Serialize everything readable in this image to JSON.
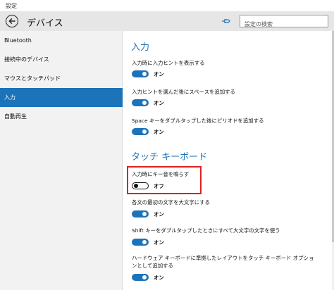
{
  "window": {
    "title": "設定"
  },
  "header": {
    "title": "デバイス",
    "search_placeholder": "設定の検索"
  },
  "sidebar": {
    "items": [
      {
        "label": "Bluetooth",
        "selected": false
      },
      {
        "label": "接続中のデバイス",
        "selected": false
      },
      {
        "label": "マウスとタッチパッド",
        "selected": false
      },
      {
        "label": "入力",
        "selected": true
      },
      {
        "label": "自動再生",
        "selected": false
      }
    ]
  },
  "content": {
    "input_section": {
      "title": "入力",
      "settings": [
        {
          "label": "入力時に入力ヒントを表示する",
          "state": "オン",
          "on": true
        },
        {
          "label": "入力ヒントを選んだ後にスペースを追加する",
          "state": "オン",
          "on": true
        },
        {
          "label": "Space キーをダブルタップした後にピリオドを追加する",
          "state": "オン",
          "on": true
        }
      ]
    },
    "touch_keyboard_section": {
      "title": "タッチ キーボード",
      "settings": [
        {
          "label": "入力時にキー音を鳴らす",
          "state": "オフ",
          "on": false,
          "highlighted": true
        },
        {
          "label": "各文の最初の文字を大文字にする",
          "state": "オン",
          "on": true
        },
        {
          "label": "Shift キーをダブルタップしたときにすべて大文字の文字を使う",
          "state": "オン",
          "on": true
        },
        {
          "label": "ハードウェア キーボードに準拠したレイアウトをタッチ キーボード オプションとして追加する",
          "state": "オン",
          "on": true
        }
      ]
    }
  },
  "colors": {
    "accent": "#1b73b9",
    "highlight_border": "#e02020",
    "sidebar_bg": "#f2f2f2",
    "header_bg": "#e6e6e6"
  },
  "icons": {
    "back": "back-arrow-icon",
    "pin": "pin-icon"
  }
}
